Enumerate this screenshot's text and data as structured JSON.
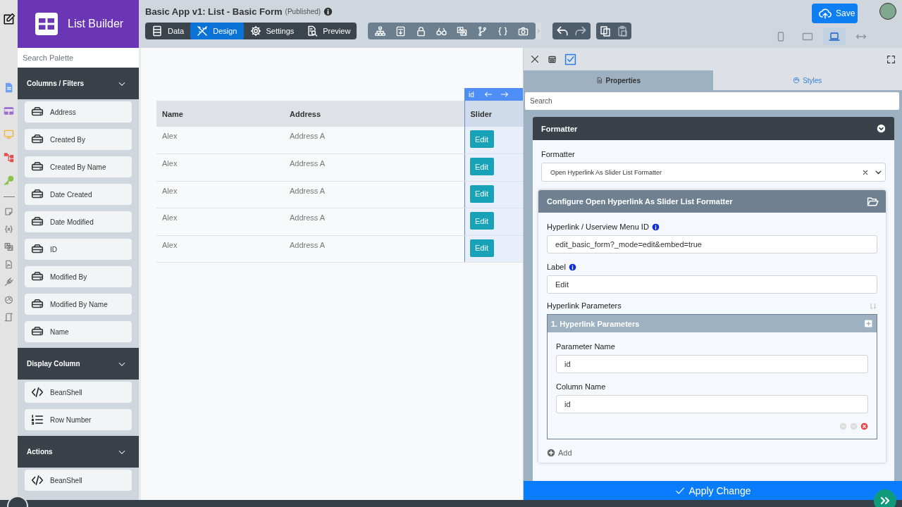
{
  "app": {
    "title": "List Builder"
  },
  "palette": {
    "search_placeholder": "Search Palette",
    "sections": [
      {
        "title": "Columns / Filters",
        "items": [
          {
            "label": "Address",
            "kind": "field"
          },
          {
            "label": "Created By",
            "kind": "field"
          },
          {
            "label": "Created By Name",
            "kind": "field"
          },
          {
            "label": "Date Created",
            "kind": "field"
          },
          {
            "label": "Date Modified",
            "kind": "field"
          },
          {
            "label": "ID",
            "kind": "field"
          },
          {
            "label": "Modified By",
            "kind": "field"
          },
          {
            "label": "Modified By Name",
            "kind": "field"
          },
          {
            "label": "Name",
            "kind": "field"
          }
        ]
      },
      {
        "title": "Display Column",
        "items": [
          {
            "label": "BeanShell",
            "kind": "code"
          },
          {
            "label": "Row Number",
            "kind": "numbered"
          }
        ]
      },
      {
        "title": "Actions",
        "items": [
          {
            "label": "BeanShell",
            "kind": "code"
          }
        ]
      }
    ]
  },
  "header": {
    "title": "Basic App v1: List - Basic Form",
    "status": "(Published)",
    "save": "Save",
    "modes": [
      {
        "label": "Data",
        "kind": "data",
        "selected": false
      },
      {
        "label": "Design",
        "kind": "design",
        "selected": true
      },
      {
        "label": "Settings",
        "kind": "settings",
        "selected": false
      },
      {
        "label": "Preview",
        "kind": "preview",
        "selected": false
      }
    ],
    "devices": [
      {
        "kind": "phone",
        "selected": false
      },
      {
        "kind": "tablet",
        "selected": false
      },
      {
        "kind": "laptop",
        "selected": true
      },
      {
        "kind": "full",
        "selected": false
      }
    ]
  },
  "table": {
    "column_tag": "id",
    "columns": [
      {
        "label": "Name",
        "selected": false
      },
      {
        "label": "Address",
        "selected": false
      },
      {
        "label": "Slider",
        "selected": true
      }
    ],
    "rows": [
      {
        "name": "Alex",
        "address": "Address A",
        "action": "Edit"
      },
      {
        "name": "Alex",
        "address": "Address A",
        "action": "Edit"
      },
      {
        "name": "Alex",
        "address": "Address A",
        "action": "Edit"
      },
      {
        "name": "Alex",
        "address": "Address A",
        "action": "Edit"
      },
      {
        "name": "Alex",
        "address": "Address A",
        "action": "Edit"
      }
    ]
  },
  "panel": {
    "tabs": [
      {
        "label": "Properties",
        "kind": "properties",
        "selected": true
      },
      {
        "label": "Styles",
        "kind": "styles",
        "selected": false
      }
    ],
    "search_placeholder": "Search",
    "section_title": "Formatter",
    "formatter_label": "Formatter",
    "formatter_value": "Open Hyperlink As Slider List Formatter",
    "config_title": "Configure Open Hyperlink As Slider List Formatter",
    "fields": [
      {
        "label": "Hyperlink / Userview Menu ID",
        "info": true,
        "value": "edit_basic_form?_mode=edit&embed=true"
      },
      {
        "label": "Label",
        "info": true,
        "value": "Edit"
      }
    ],
    "params_label": "Hyperlink Parameters",
    "param_groups": [
      {
        "title": "1. Hyperlink Parameters",
        "fields": [
          {
            "label": "Parameter Name",
            "value": "id"
          },
          {
            "label": "Column Name",
            "value": "id"
          }
        ]
      }
    ],
    "add": "Add",
    "apply": "Apply Change"
  }
}
